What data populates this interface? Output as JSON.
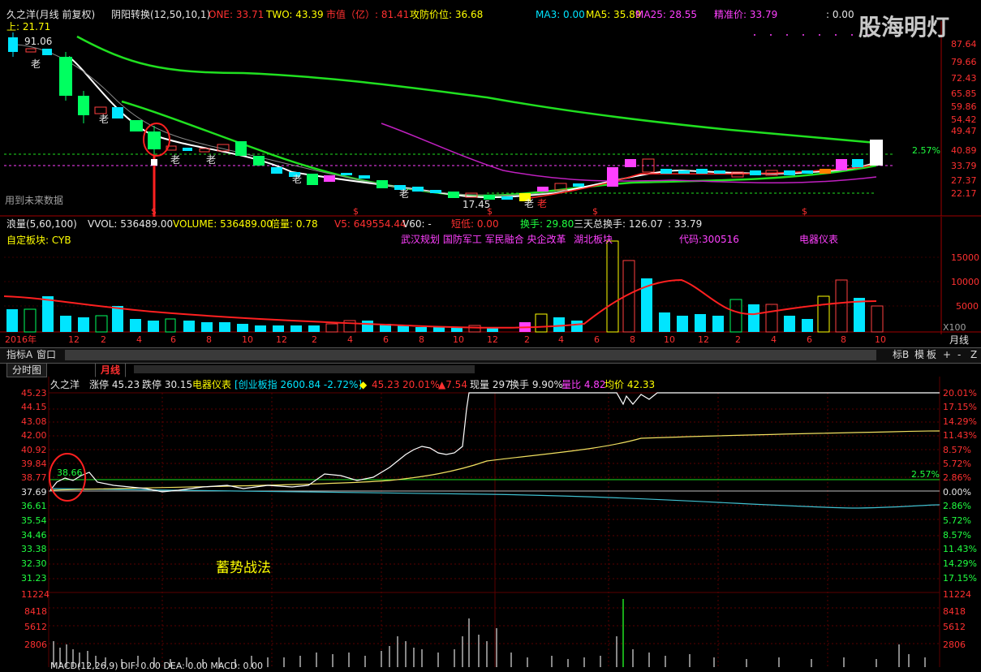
{
  "kline_header": {
    "stock": "久之洋(月线 前复权)",
    "indicator": "阴阳转换(12,50,10,1)",
    "one": "ONE: 33.71",
    "two": "TWO: 43.39",
    "market_cap": "市值（亿）: 81.41",
    "attack_defense": "攻防价位: 36.68",
    "ma3": "MA3: 0.00",
    "ma5": "MA5: 35.89",
    "ma25": "MA25: 28.55",
    "precise": "精准价: 33.79",
    "zero": ": 0.00"
  },
  "watermark": "股海明灯",
  "kline_left_labels": {
    "up": "上: 21.71",
    "price": "91.06",
    "future": "用到未来数据",
    "low": "17.45"
  },
  "kline_y_axis": [
    "87.64",
    "79.66",
    "72.43",
    "65.85",
    "59.86",
    "54.42",
    "49.47",
    "40.89",
    "33.79",
    "27.37",
    "22.17"
  ],
  "kline_pct": "2.57%",
  "kline_markers": [
    "老",
    "老",
    "老",
    "老",
    "老",
    "老",
    "老",
    "老"
  ],
  "buy_marks": [
    "$",
    "$",
    "$",
    "$",
    "$"
  ],
  "volume_header": {
    "name": "浪量(5,60,100)",
    "vvol": "VVOL: 536489.00",
    "volume": "VOLUME: 536489.00",
    "ratio": "倍量: 0.78",
    "v5": "V5: 649554.44",
    "v60": "V60: -",
    "short_low": "短低: 0.00",
    "turnover": "换手: 29.80",
    "three_day": "三天总换手: 126.07",
    "dot": ": 33.79"
  },
  "sector_line": {
    "label": "自定板块: CYB",
    "concepts": "武汉规划 国防军工 军民融合 央企改革",
    "region": "湖北板块",
    "code": "代码:300516",
    "industry": "电器仪表"
  },
  "volume_y_axis": [
    "15000",
    "10000",
    "5000",
    "X100"
  ],
  "date_axis": [
    "2016年",
    "12",
    "2",
    "4",
    "6",
    "8",
    "10",
    "12",
    "2",
    "4",
    "6",
    "8",
    "10",
    "12",
    "2",
    "4",
    "6",
    "8",
    "10",
    "12",
    "2",
    "4",
    "6",
    "8",
    "10"
  ],
  "period_label": "月线",
  "toolbar": {
    "indicator_a": "指标A",
    "window": "窗口",
    "board": "标B",
    "template": "模",
    "panel": "板",
    "plus": "+",
    "minus": "-",
    "z": "Z"
  },
  "tabs": [
    {
      "label": "分时图"
    },
    {
      "label": "月线"
    }
  ],
  "intraday_header": {
    "name": "久之洋",
    "limit_up": "涨停 45.23",
    "limit_down": "跌停 30.15",
    "industry": "电器仪表",
    "index": "[创业板指 2600.84 -2.72%]",
    "price": "45.23",
    "pct": "20.01%",
    "change": "▲7.54",
    "now_vol": "现量 297",
    "turnover": "换手 9.90%",
    "vol_ratio": "量比 4.82",
    "avg": "均价 42.33"
  },
  "intraday_left_axis": [
    "45.23",
    "44.15",
    "43.08",
    "42.00",
    "40.92",
    "39.84",
    "38.77",
    "37.69",
    "36.61",
    "35.54",
    "34.46",
    "33.38",
    "32.30",
    "31.23"
  ],
  "intraday_right_axis": [
    "20.01%",
    "17.15%",
    "14.29%",
    "11.43%",
    "8.57%",
    "5.72%",
    "2.86%",
    "0.00%",
    "2.86%",
    "5.72%",
    "8.57%",
    "11.43%",
    "14.29%",
    "17.15%"
  ],
  "intraday_annotation": "38.66",
  "intraday_pct_line": "2.57%",
  "strategy_label": "蓄势战法",
  "intraday_vol_axis": [
    "11224",
    "8418",
    "5612",
    "2806"
  ],
  "macd_label": "MACD(12,26,9) DIF: 0.00  DEA: 0.00  MACD: 0.00",
  "chart_data": {
    "type": "line",
    "title": "",
    "intraday_price": {
      "prev_close": 37.69,
      "high": 45.23,
      "circle_value": 38.66
    }
  }
}
